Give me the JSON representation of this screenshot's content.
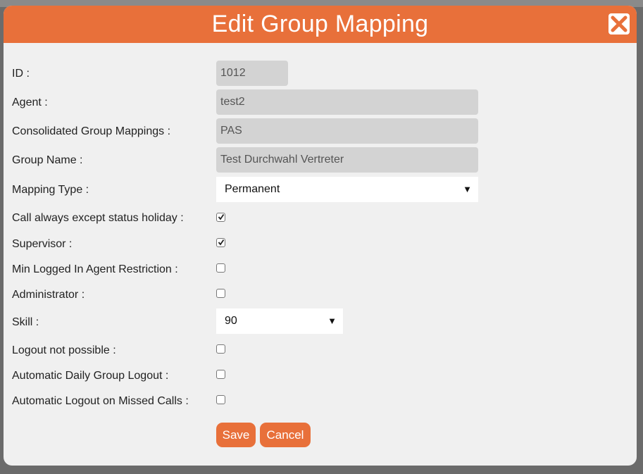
{
  "dialog": {
    "title": "Edit Group Mapping",
    "accent_color": "#e8703a",
    "close_icon": "close-x-icon"
  },
  "fields": {
    "id": {
      "label": "ID :",
      "value": "1012"
    },
    "agent": {
      "label": "Agent :",
      "value": "test2"
    },
    "consolidated": {
      "label": "Consolidated Group Mappings :",
      "value": "PAS"
    },
    "group_name": {
      "label": "Group Name :",
      "value": "Test Durchwahl Vertreter"
    },
    "mapping_type": {
      "label": "Mapping Type :",
      "value": "Permanent"
    },
    "call_always": {
      "label": "Call always except status holiday :",
      "checked": true
    },
    "supervisor": {
      "label": "Supervisor :",
      "checked": true
    },
    "min_logged": {
      "label": "Min Logged In Agent Restriction :",
      "checked": false
    },
    "administrator": {
      "label": "Administrator :",
      "checked": false
    },
    "skill": {
      "label": "Skill :",
      "value": "90"
    },
    "logout_not_possible": {
      "label": "Logout not possible :",
      "checked": false
    },
    "auto_daily_logout": {
      "label": "Automatic Daily Group Logout :",
      "checked": false
    },
    "auto_logout_missed": {
      "label": "Automatic Logout on Missed Calls :",
      "checked": false
    }
  },
  "buttons": {
    "save": "Save",
    "cancel": "Cancel"
  }
}
